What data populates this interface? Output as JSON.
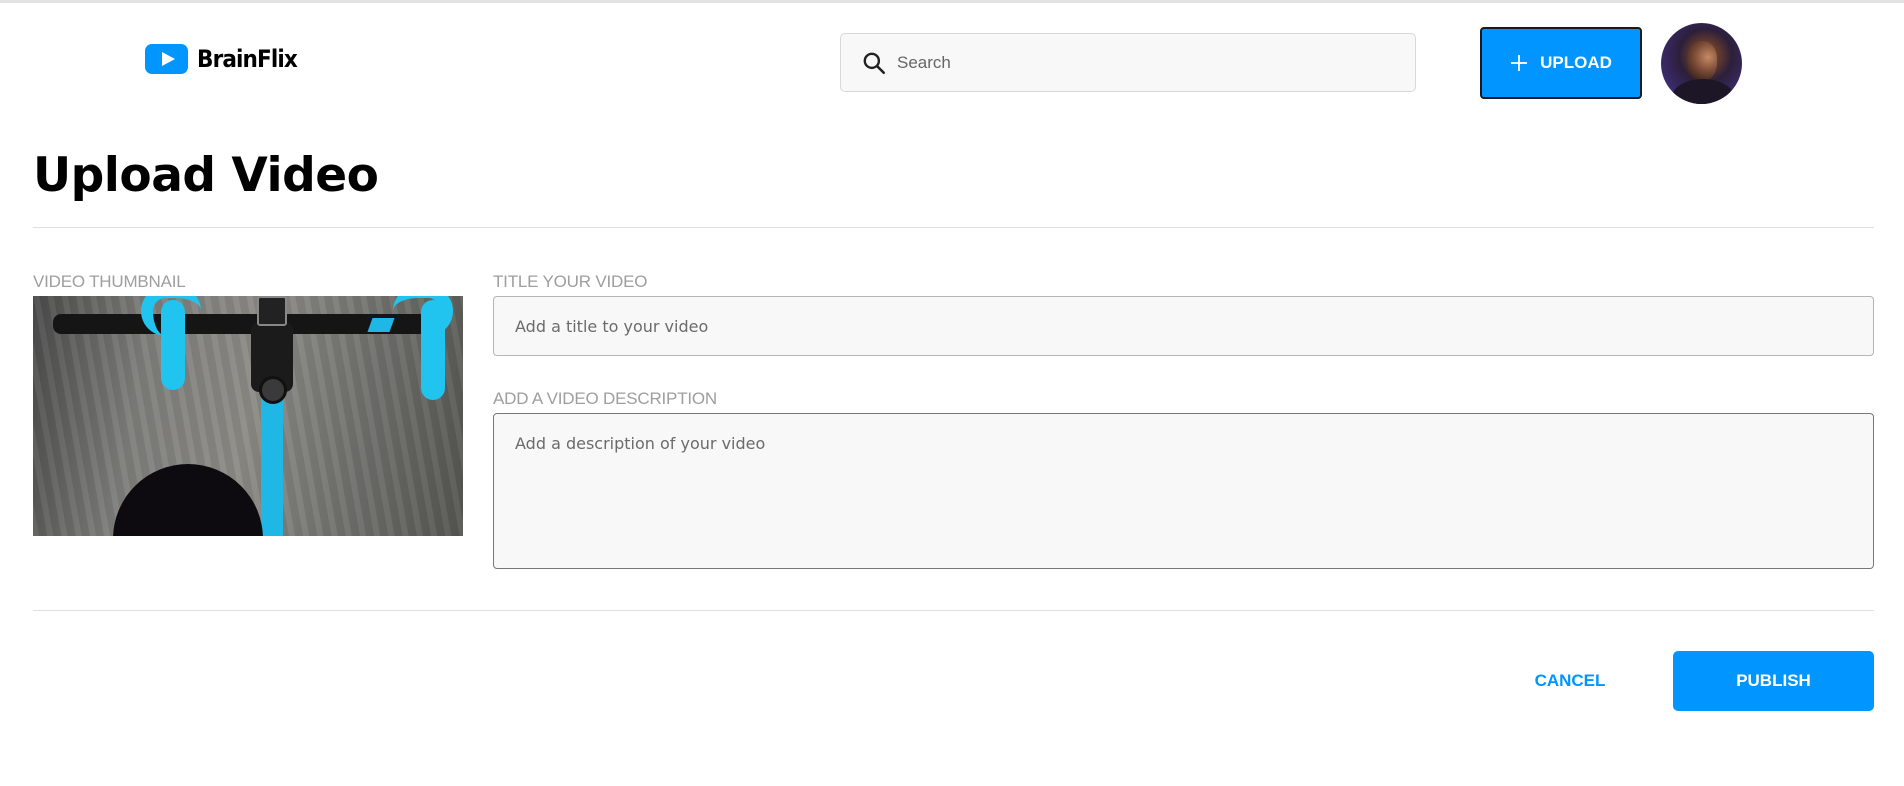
{
  "header": {
    "brand": "BrainFlix",
    "search": {
      "placeholder": "Search",
      "value": ""
    },
    "upload_label": "UPLOAD"
  },
  "page": {
    "title": "Upload Video"
  },
  "form": {
    "thumbnail_label": "VIDEO THUMBNAIL",
    "title_label": "TITLE YOUR VIDEO",
    "title_placeholder": "Add a title to your video",
    "description_label": "ADD A VIDEO DESCRIPTION",
    "description_placeholder": "Add a description of your video"
  },
  "actions": {
    "cancel_label": "CANCEL",
    "publish_label": "PUBLISH"
  },
  "colors": {
    "accent": "#0095ff",
    "label_gray": "#9e9e9e",
    "field_bg": "#f8f8f8",
    "divider": "#e0e0e0"
  },
  "icons": {
    "logo": "play-icon",
    "search": "search-icon",
    "upload": "plus-icon"
  }
}
